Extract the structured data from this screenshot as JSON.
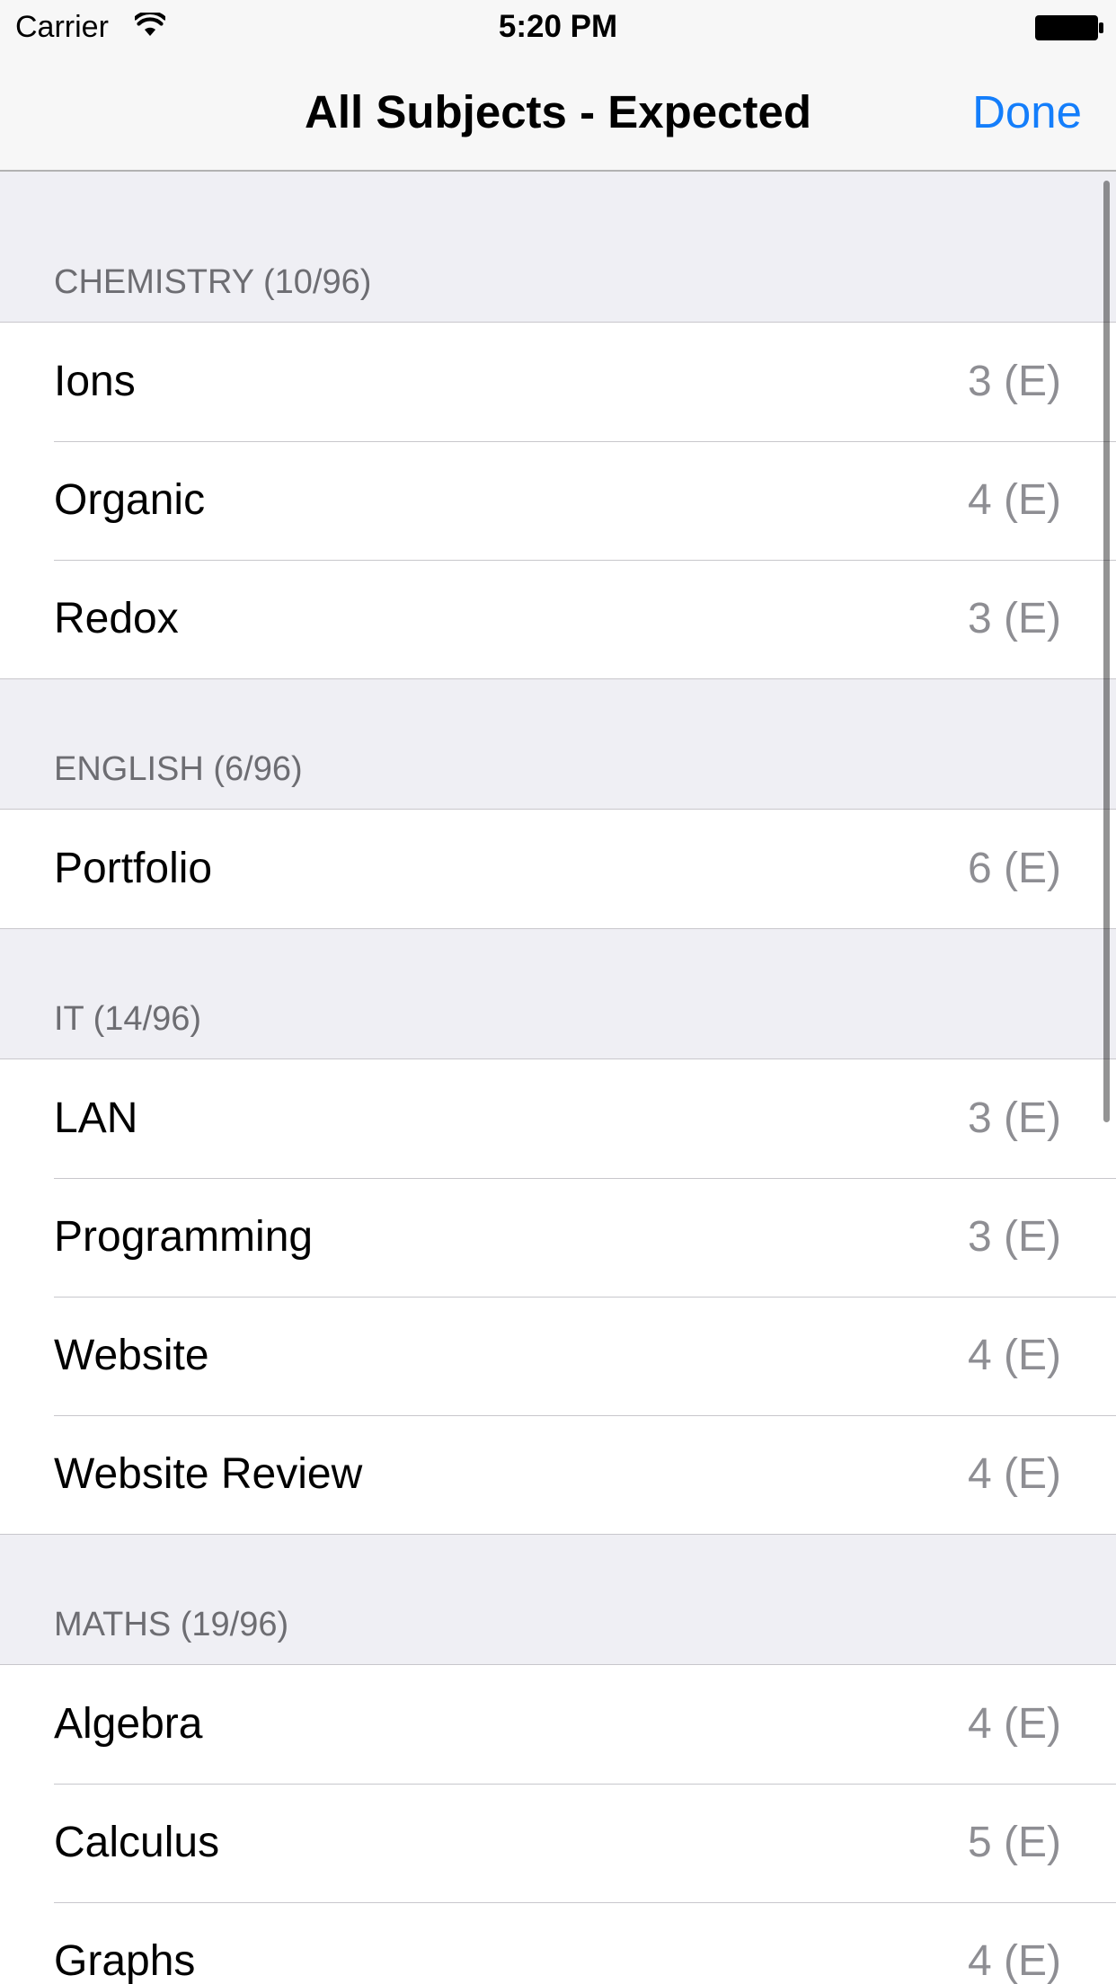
{
  "status_bar": {
    "carrier": "Carrier",
    "time": "5:20 PM",
    "wifi_icon": "wifi-icon",
    "battery_icon": "battery-icon"
  },
  "nav": {
    "title": "All Subjects - Expected",
    "done_label": "Done"
  },
  "colors": {
    "accent": "#147efb",
    "detail_text": "#8e8e93",
    "section_header_text": "#6d6d72",
    "grouped_background": "#efeff4"
  },
  "sections": [
    {
      "header": "CHEMISTRY (10/96)",
      "rows": [
        {
          "title": "Ions",
          "detail": "3 (E)"
        },
        {
          "title": "Organic",
          "detail": "4 (E)"
        },
        {
          "title": "Redox",
          "detail": "3 (E)"
        }
      ]
    },
    {
      "header": "ENGLISH (6/96)",
      "rows": [
        {
          "title": "Portfolio",
          "detail": "6 (E)"
        }
      ]
    },
    {
      "header": "IT (14/96)",
      "rows": [
        {
          "title": "LAN",
          "detail": "3 (E)"
        },
        {
          "title": "Programming",
          "detail": "3 (E)"
        },
        {
          "title": "Website",
          "detail": "4 (E)"
        },
        {
          "title": "Website Review",
          "detail": "4 (E)"
        }
      ]
    },
    {
      "header": "MATHS (19/96)",
      "rows": [
        {
          "title": "Algebra",
          "detail": "4 (E)"
        },
        {
          "title": "Calculus",
          "detail": "5 (E)"
        },
        {
          "title": "Graphs",
          "detail": "4 (E)"
        }
      ]
    }
  ]
}
